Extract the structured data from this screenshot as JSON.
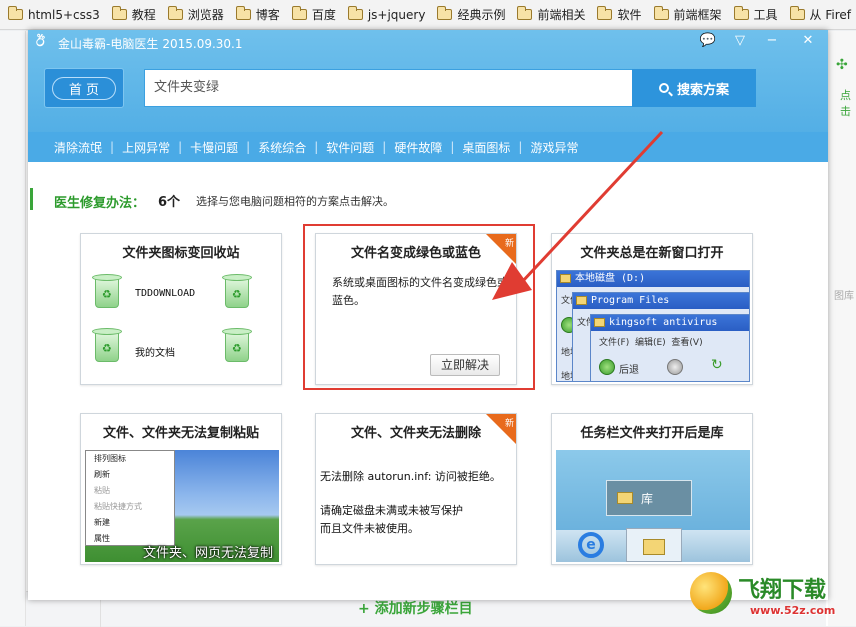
{
  "bookmarks": [
    "html5+css3",
    "教程",
    "浏览器",
    "博客",
    "百度",
    "js+jquery",
    "经典示例",
    "前端相关",
    "软件",
    "前端框架",
    "工具",
    "从 Firef"
  ],
  "background": {
    "right_label": "点击",
    "right_fade": "图库",
    "add_step": "+ 添加新步骤栏目"
  },
  "window": {
    "title": "金山毒霸-电脑医生",
    "version": "2015.09.30.1",
    "home_label": "首 页",
    "search_value": "文件夹变绿",
    "search_button": "搜索方案",
    "categories": [
      "清除流氓",
      "上网异常",
      "卡慢问题",
      "系统综合",
      "软件问题",
      "硬件故障",
      "桌面图标",
      "游戏异常"
    ]
  },
  "fix": {
    "label": "医生修复办法：",
    "count": "6个",
    "hint": "选择与您电脑问题相符的方案点击解决。"
  },
  "cards": [
    {
      "title": "文件夹图标变回收站",
      "items": [
        "TDDOWNLOAD",
        "我的文档"
      ]
    },
    {
      "title": "文件名变成绿色或蓝色",
      "desc": "系统或桌面图标的文件名变成绿色或蓝色。",
      "button": "立即解决",
      "badge": "新"
    },
    {
      "title": "文件夹总是在新窗口打开",
      "win1": "本地磁盘 (D:)",
      "win2": "Program Files",
      "win3": "kingsoft antivirus",
      "menu_file": "文件",
      "menu_edit": "编辑",
      "menu_view": "查看",
      "back": "后退",
      "addr": "地址"
    },
    {
      "title": "文件、文件夹无法复制粘贴",
      "menu": [
        "排列图标",
        "刷新",
        "粘贴",
        "粘贴快捷方式",
        "新建",
        "属性"
      ],
      "overlay": "文件夹、网页无法复制"
    },
    {
      "title": "文件、文件夹无法删除",
      "line1": "无法删除  autorun.inf: 访问被拒绝。",
      "line2": "请确定磁盘未满或未被写保护",
      "line3": "而且文件未被使用。",
      "badge": "新"
    },
    {
      "title": "任务栏文件夹打开后是库",
      "lib": "库"
    }
  ],
  "watermark": {
    "name": "飞翔下载",
    "url": "www.52z.com"
  },
  "colors": {
    "title_blue": "#52aee5",
    "cat_bar": "#4aaae6",
    "highlight": "#e03c32",
    "accent_green": "#3aa53a",
    "ribbon": "#e86a1c"
  }
}
